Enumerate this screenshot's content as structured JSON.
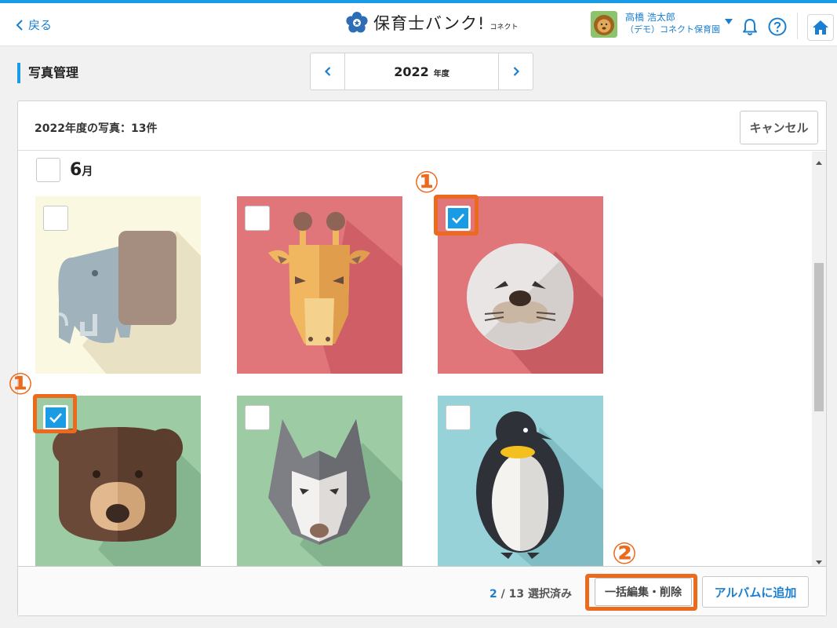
{
  "header": {
    "back_label": "戻る",
    "logo_text": "保育士バンク!",
    "logo_sub": "コネクト",
    "user_name": "高橋 浩太郎",
    "user_org": "（デモ）コネクト保育園"
  },
  "page": {
    "section_title": "写真管理"
  },
  "year_nav": {
    "year": "2022",
    "unit": "年度"
  },
  "panel": {
    "count_text": "2022年度の写真：13件",
    "cancel_label": "キャンセル",
    "month_number": "6",
    "month_unit": "月"
  },
  "photos": [
    {
      "animal": "elephant",
      "bg": "#fbf8e2",
      "checked": false
    },
    {
      "animal": "giraffe",
      "bg": "#e0767a",
      "checked": false
    },
    {
      "animal": "seal",
      "bg": "#e0767a",
      "checked": true
    },
    {
      "animal": "bear",
      "bg": "#9ccba4",
      "checked": true
    },
    {
      "animal": "wolf",
      "bg": "#9ccba4",
      "checked": false
    },
    {
      "animal": "penguin",
      "bg": "#96d2d8",
      "checked": false
    }
  ],
  "annotations": {
    "marker_1": "①",
    "marker_2": "②"
  },
  "footer": {
    "selected_count": "2",
    "total_text": "/ 13",
    "selected_label": "選択済み",
    "bulk_label": "一括編集・削除",
    "album_label": "アルバムに追加"
  },
  "colors": {
    "accent": "#1a9be6",
    "link": "#1a7fd0",
    "highlight": "#ec6a1d"
  }
}
